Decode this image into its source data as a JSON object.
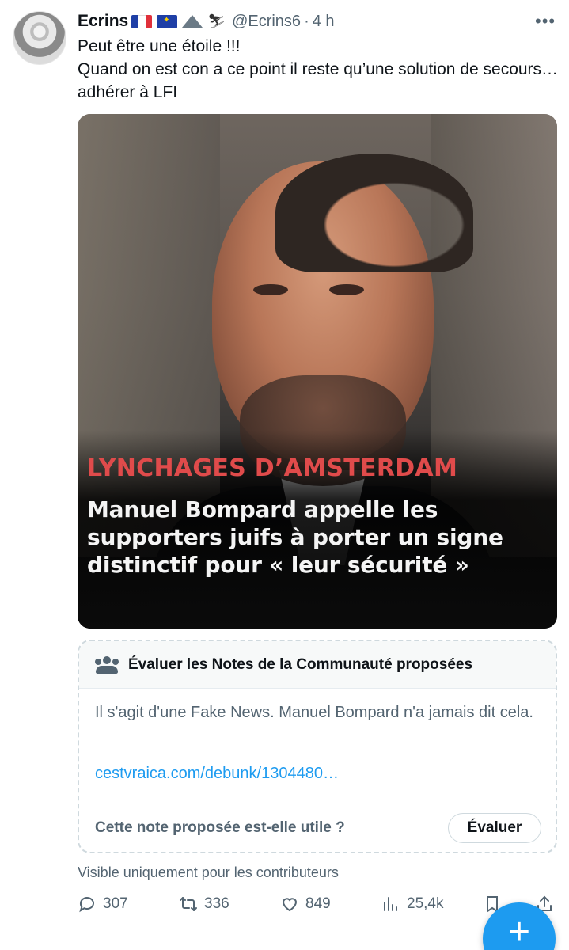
{
  "tweet": {
    "author_name": "Ecrins",
    "handle": "@Ecrins6",
    "separator": "·",
    "time": "4 h",
    "text_line1": "Peut être une étoile !!!",
    "text_line2": "Quand on est con a ce point il reste qu’une solution de secours…adhérer à LFI"
  },
  "media": {
    "headline_red": "LYNCHAGES D’AMSTERDAM",
    "headline_white": "Manuel Bompard appelle les supporters juifs à porter un signe distinctif pour « leur sécurité »"
  },
  "community_note": {
    "title": "Évaluer les Notes de la Communauté proposées",
    "body": "Il s'agit d'une Fake News. Manuel Bompard n'a jamais dit cela.",
    "link": "cestvraica.com/debunk/1304480…",
    "question": "Cette note proposée est-elle utile ?",
    "rate_label": "Évaluer"
  },
  "visibility_note": "Visible uniquement pour les contributeurs",
  "stats": {
    "replies": "307",
    "reposts": "336",
    "likes": "849",
    "views": "25,4k"
  },
  "colors": {
    "accent": "#1d9bf0",
    "text_primary": "#0f1419",
    "text_secondary": "#536471",
    "headline_red": "#e04b4b"
  },
  "icons": [
    "more-icon",
    "people-icon",
    "reply-icon",
    "repost-icon",
    "like-icon",
    "views-icon",
    "bookmark-icon",
    "share-icon",
    "compose-plus-icon"
  ]
}
